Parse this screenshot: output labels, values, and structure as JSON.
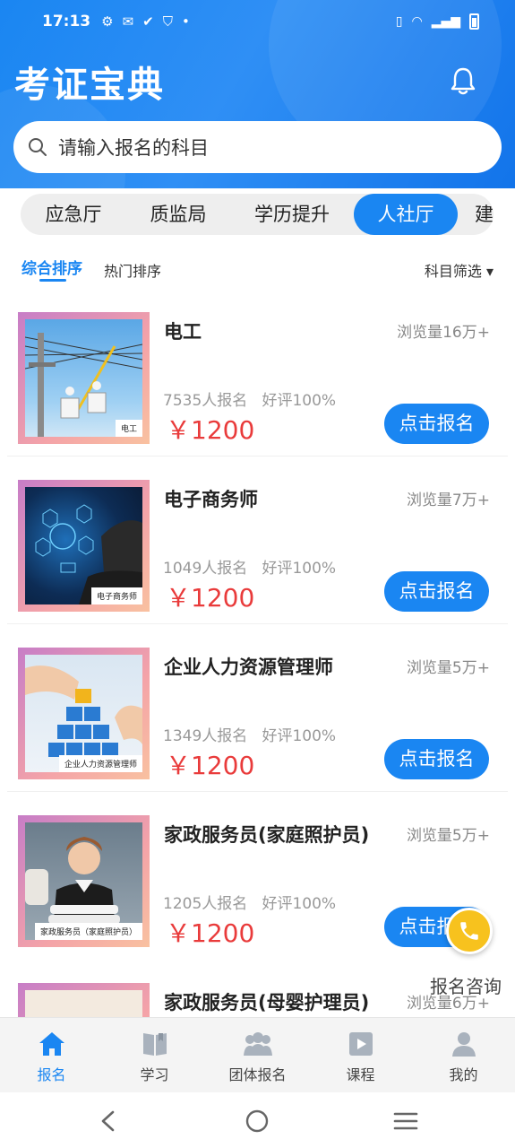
{
  "status_bar": {
    "time": "17:13"
  },
  "header": {
    "app_title": "考证宝典",
    "search_placeholder": "请输入报名的科目"
  },
  "category_tabs": [
    {
      "label": "应急厅",
      "active": false
    },
    {
      "label": "质监局",
      "active": false
    },
    {
      "label": "学历提升",
      "active": false
    },
    {
      "label": "人社厅",
      "active": true
    },
    {
      "label": "建",
      "active": false
    }
  ],
  "sort": {
    "comprehensive": "综合排序",
    "hot": "热门排序",
    "filter": "科目筛选 ▾"
  },
  "courses": [
    {
      "title": "电工",
      "views": "浏览量16万+",
      "stats": "7535人报名   好评100%",
      "price": "￥1200",
      "button": "点击报名",
      "thumb_caption": "电工"
    },
    {
      "title": "电子商务师",
      "views": "浏览量7万+",
      "stats": "1049人报名   好评100%",
      "price": "￥1200",
      "button": "点击报名",
      "thumb_caption": "电子商务师"
    },
    {
      "title": "企业人力资源管理师",
      "views": "浏览量5万+",
      "stats": "1349人报名   好评100%",
      "price": "￥1200",
      "button": "点击报名",
      "thumb_caption": "企业人力资源管理师"
    },
    {
      "title": "家政服务员(家庭照护员)",
      "views": "浏览量5万+",
      "stats": "1205人报名   好评100%",
      "price": "￥1200",
      "button": "点击报名",
      "thumb_caption": "家政服务员（家庭照护员）"
    },
    {
      "title": "家政服务员(母婴护理员)",
      "views": "浏览量6万+"
    }
  ],
  "consult": {
    "label": "报名咨询"
  },
  "bottom_nav": [
    {
      "label": "报名",
      "icon": "home-icon",
      "active": true
    },
    {
      "label": "学习",
      "icon": "book-icon",
      "active": false
    },
    {
      "label": "团体报名",
      "icon": "group-icon",
      "active": false
    },
    {
      "label": "课程",
      "icon": "video-icon",
      "active": false
    },
    {
      "label": "我的",
      "icon": "user-icon",
      "active": false
    }
  ],
  "colors": {
    "primary": "#1a86f2",
    "price": "#e93b3b",
    "fab": "#f7c21e"
  }
}
